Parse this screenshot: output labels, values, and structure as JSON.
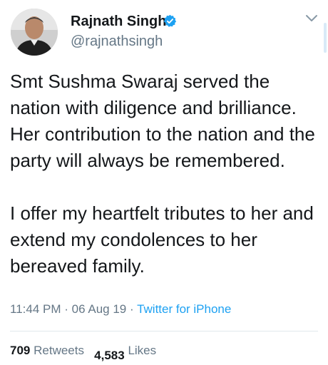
{
  "user": {
    "display_name": "Rajnath Singh",
    "handle": "@rajnathsingh",
    "verified": true
  },
  "tweet": {
    "paragraphs": [
      "Smt Sushma Swaraj served the nation with diligence and brilliance. Her contribution to the nation and the party will always be remembered.",
      "I offer my heartfelt tributes to her and extend my condolences to her bereaved family."
    ],
    "time": "11:44 PM",
    "separator": "·",
    "date": "06 Aug 19",
    "source": "Twitter for iPhone"
  },
  "stats": {
    "retweets_count": "709",
    "retweets_label": "Retweets",
    "likes_count": "4,583",
    "likes_label": "Likes"
  },
  "colors": {
    "accent": "#1da1f2",
    "secondary_text": "#657786",
    "primary_text": "#14171a"
  },
  "icons": {
    "verified": "verified-badge-icon",
    "caret": "chevron-down-icon"
  }
}
